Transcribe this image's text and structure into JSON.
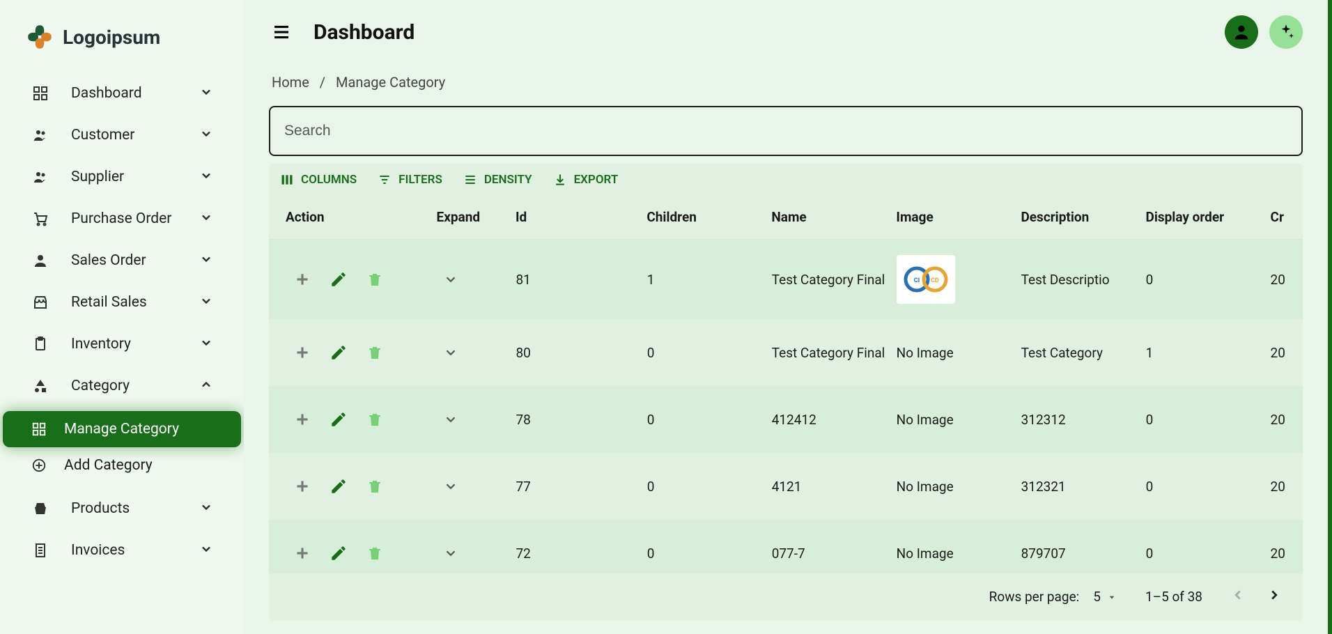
{
  "brand": "Logoipsum",
  "header": {
    "title": "Dashboard"
  },
  "breadcrumb": {
    "home": "Home",
    "current": "Manage Category"
  },
  "search": {
    "placeholder": "Search"
  },
  "sidebar": {
    "items": [
      {
        "label": "Dashboard"
      },
      {
        "label": "Customer"
      },
      {
        "label": "Supplier"
      },
      {
        "label": "Purchase Order"
      },
      {
        "label": "Sales Order"
      },
      {
        "label": "Retail Sales"
      },
      {
        "label": "Inventory"
      },
      {
        "label": "Category"
      },
      {
        "label": "Products"
      },
      {
        "label": "Invoices"
      }
    ],
    "category_sub": [
      {
        "label": "Manage Category"
      },
      {
        "label": "Add Category"
      }
    ]
  },
  "toolbar": {
    "columns": "COLUMNS",
    "filters": "FILTERS",
    "density": "DENSITY",
    "export": "EXPORT"
  },
  "grid": {
    "headers": {
      "action": "Action",
      "expand": "Expand",
      "id": "Id",
      "children": "Children",
      "name": "Name",
      "image": "Image",
      "description": "Description",
      "order": "Display order",
      "created": "Cr"
    },
    "rows": [
      {
        "id": "81",
        "children": "1",
        "name": "Test Category Final",
        "image": "has",
        "description": "Test Descriptio",
        "order": "0",
        "created": "20"
      },
      {
        "id": "80",
        "children": "0",
        "name": "Test Category Final",
        "image": "No Image",
        "description": "Test Category",
        "order": "1",
        "created": "20"
      },
      {
        "id": "78",
        "children": "0",
        "name": "412412",
        "image": "No Image",
        "description": "312312",
        "order": "0",
        "created": "20"
      },
      {
        "id": "77",
        "children": "0",
        "name": "4121",
        "image": "No Image",
        "description": "312321",
        "order": "0",
        "created": "20"
      },
      {
        "id": "72",
        "children": "0",
        "name": "077-7",
        "image": "No Image",
        "description": "879707",
        "order": "0",
        "created": "20"
      }
    ],
    "footer": {
      "rpp_label": "Rows per page:",
      "rpp_value": "5",
      "range": "1–5 of 38"
    }
  }
}
